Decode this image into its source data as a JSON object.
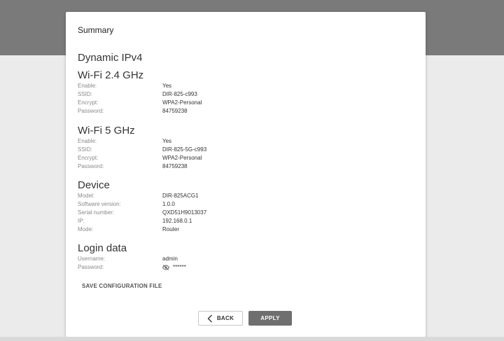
{
  "summary": {
    "title": "Summary"
  },
  "connection": {
    "title": "Dynamic IPv4"
  },
  "wifi24": {
    "title": "Wi-Fi 2.4 GHz",
    "rows": [
      {
        "label": "Enable:",
        "value": "Yes"
      },
      {
        "label": "SSID:",
        "value": "DIR-825-c993"
      },
      {
        "label": "Encrypt:",
        "value": "WPA2-Personal"
      },
      {
        "label": "Password:",
        "value": "84759238"
      }
    ]
  },
  "wifi5": {
    "title": "Wi-Fi 5 GHz",
    "rows": [
      {
        "label": "Enable:",
        "value": "Yes"
      },
      {
        "label": "SSID:",
        "value": "DIR-825-5G-c993"
      },
      {
        "label": "Encrypt:",
        "value": "WPA2-Personal"
      },
      {
        "label": "Password:",
        "value": "84759238"
      }
    ]
  },
  "device": {
    "title": "Device",
    "rows": [
      {
        "label": "Model:",
        "value": "DIR-825ACG1"
      },
      {
        "label": "Software version:",
        "value": "1.0.0"
      },
      {
        "label": "Serial number:",
        "value": "QXD51H9013037"
      },
      {
        "label": "IP:",
        "value": "192.168.0.1"
      },
      {
        "label": "Mode:",
        "value": "Router"
      }
    ]
  },
  "login": {
    "title": "Login data",
    "rows": [
      {
        "label": "Username:",
        "value": "admin"
      },
      {
        "label": "Password:",
        "value": "******"
      }
    ],
    "password_icon": "eye-slash-icon"
  },
  "actions": {
    "save_config": "SAVE CONFIGURATION FILE",
    "back": "BACK",
    "apply": "APPLY"
  },
  "colors": {
    "header_band": "#7a7a7a",
    "background": "#ebebeb",
    "apply_button": "#6f6f6f",
    "label_text": "#8a8a8a",
    "value_text": "#333333"
  }
}
